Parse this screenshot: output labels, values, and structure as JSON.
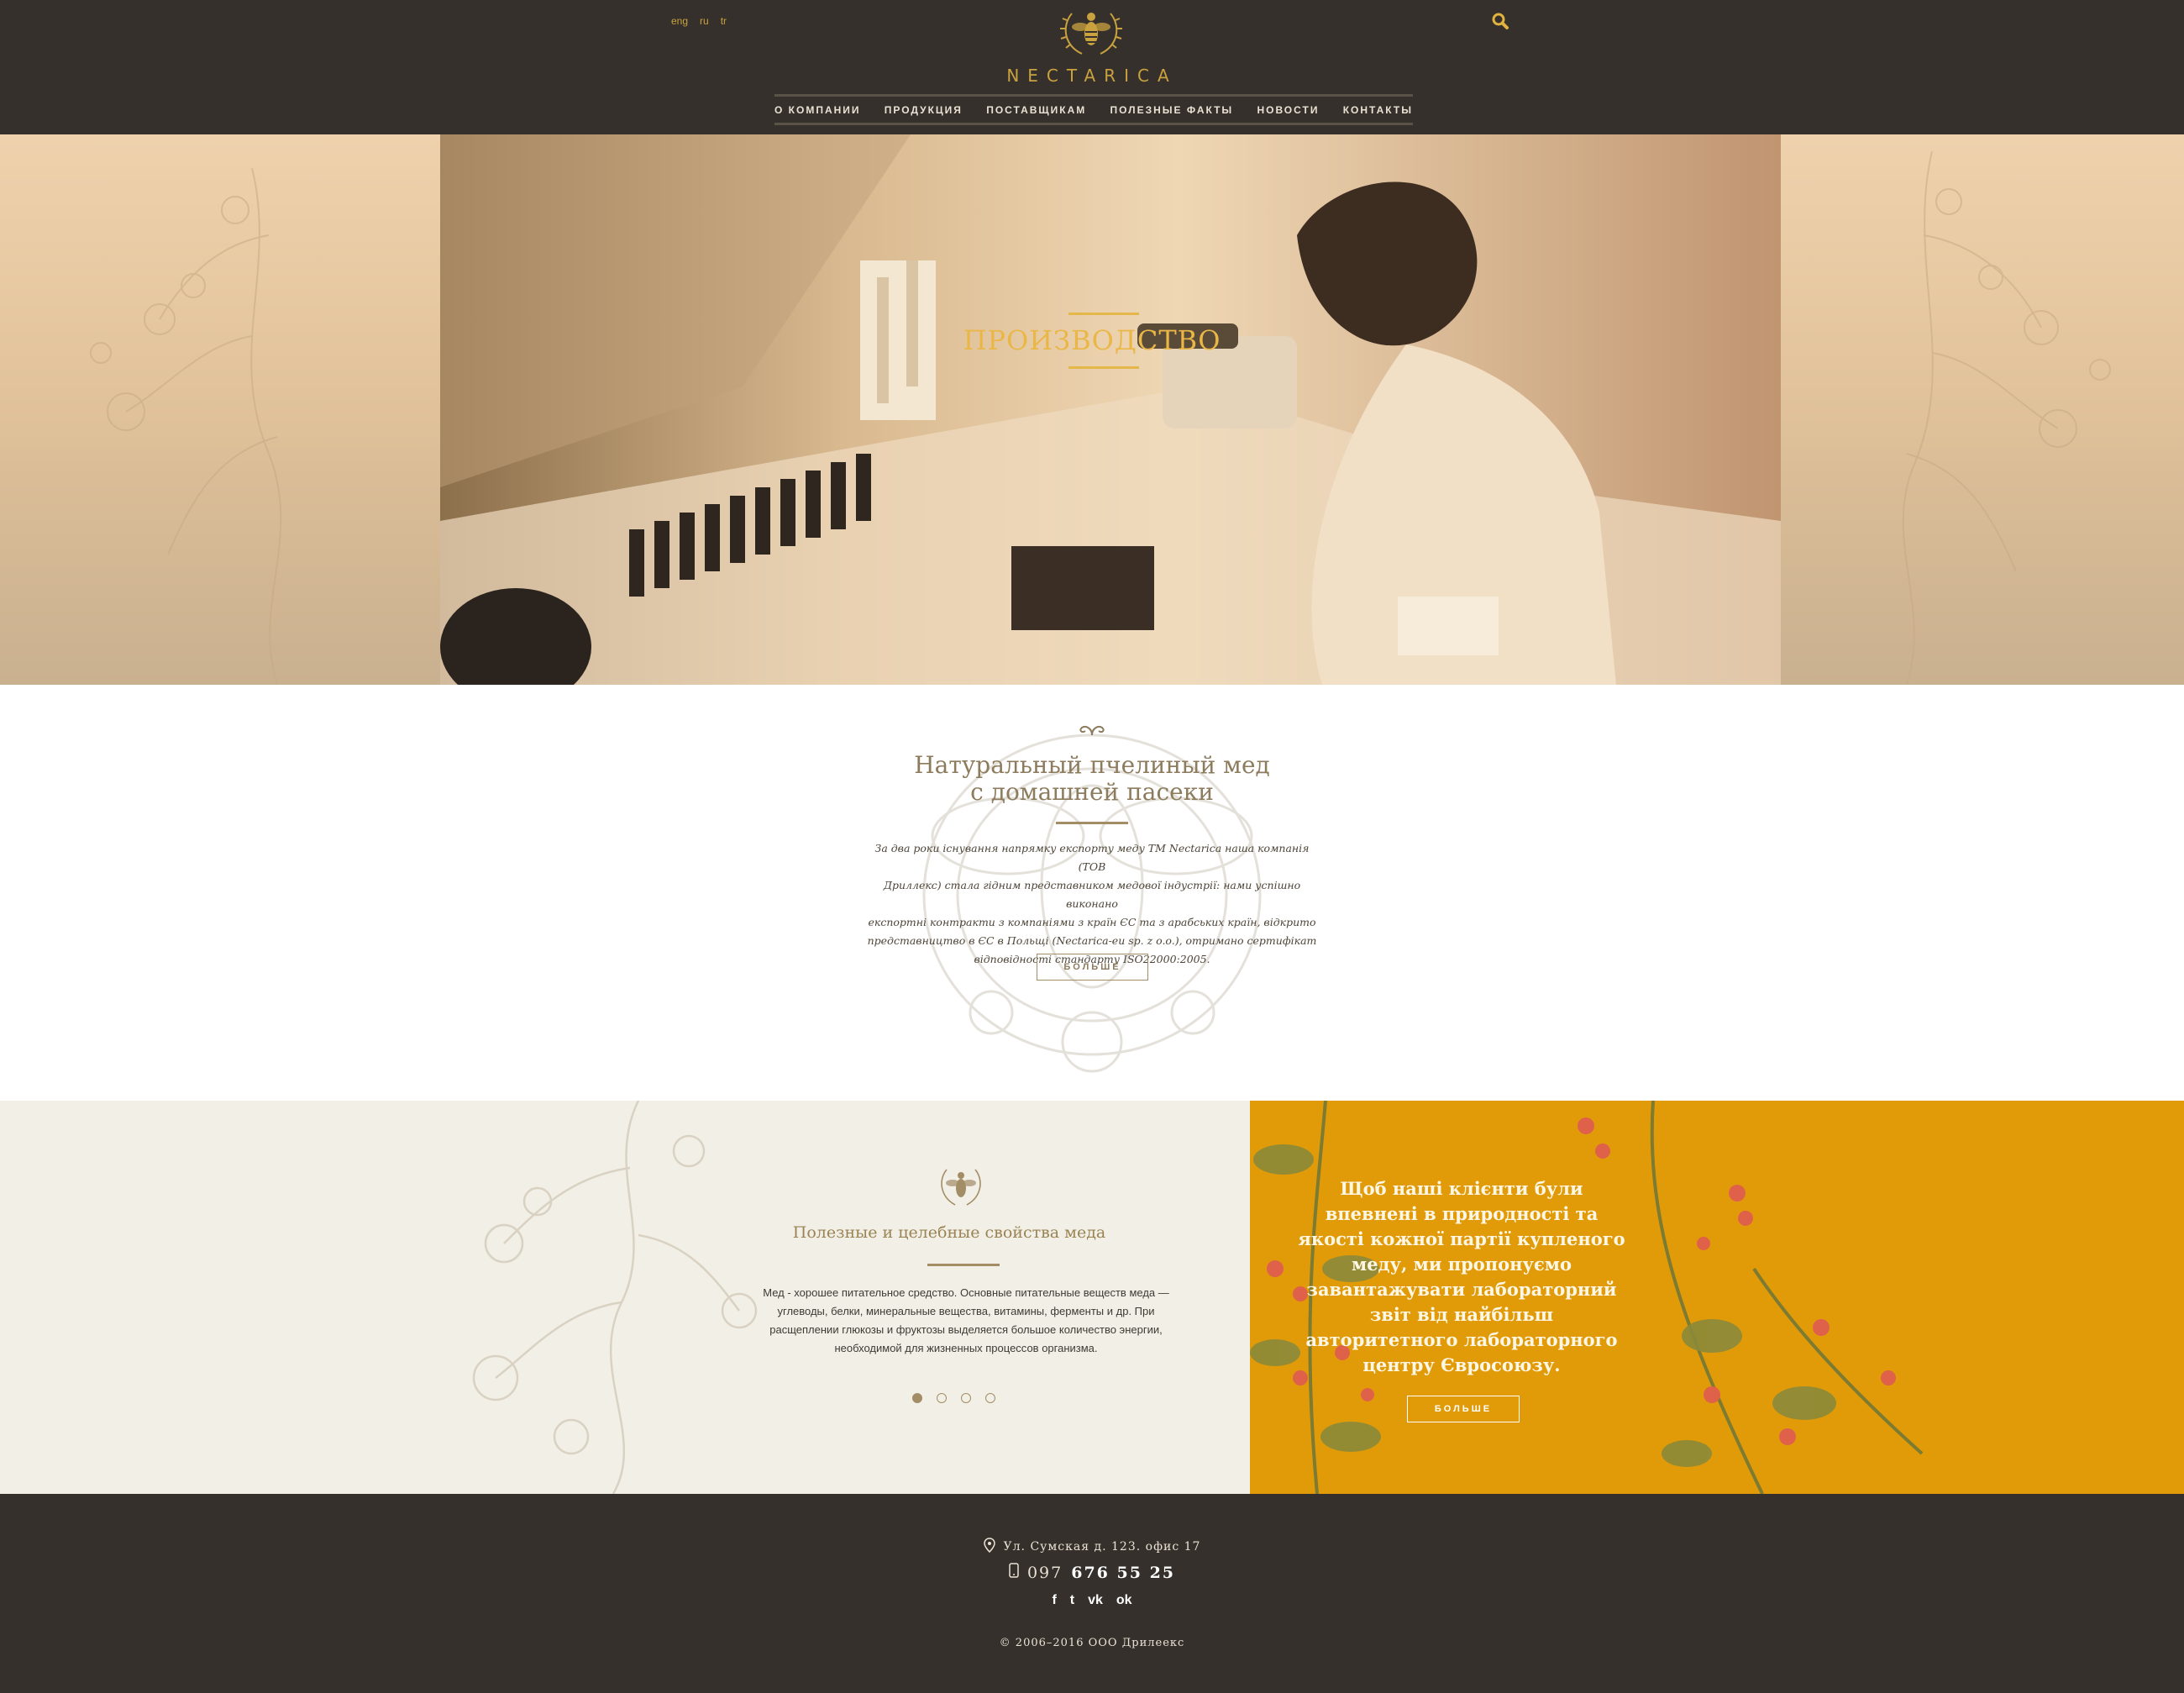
{
  "header": {
    "languages": [
      "eng",
      "ru",
      "tr"
    ],
    "logo_text": "NECTARICA",
    "nav": [
      "О КОМПАНИИ",
      "ПРОДУКЦИЯ",
      "ПОСТАВЩИКАМ",
      "ПОЛЕЗНЫЕ ФАКТЫ",
      "НОВОСТИ",
      "КОНТАКТЫ"
    ]
  },
  "hero": {
    "title": "ПРОИЗВОДСТВО",
    "colors": {
      "title": "#eab747",
      "accent_gold": "#e5b64a"
    }
  },
  "intro": {
    "title_line1": "Натуральный пчелиный мед",
    "title_line2": "с домашней пасеки",
    "text_lines": [
      "За два роки існування напрямку експорту меду ТМ Nectarica наша компанія (ТОВ",
      "Дриллекс) стала гідним представником медової індустрії: нами успішно виконано",
      "експортні контракти з компаніями з країн ЄС та з арабських країн, відкрито",
      "представництво в ЄС в Польщі (Nectarica-eu sp. z o.o.), отримано сертифікат",
      "відповідності стандарту ISO22000:2005."
    ],
    "button": "БОЛЬШЕ"
  },
  "features": {
    "title": "Полезные и целебные свойства меда",
    "text_lines": [
      "Мед - хорошее питательное средство. Основные питательные веществ меда —",
      "углеводы, белки, минеральные вещества, витамины, ферменты и др. При",
      "расщеплении глюкозы и фруктозы выделяется большое количество энергии,",
      "необходимой для жизненных процессов организма."
    ],
    "slider_count": 4,
    "slider_active": 1
  },
  "promo": {
    "text_lines": [
      "Щоб наші клієнти були",
      "впевнені в природності та",
      "якості кожної партії купленого",
      "меду, ми пропонуємо",
      "завантажувати лабораторний",
      "звіт від найбільш",
      "авторитетного лабораторного",
      "центру Євросоюзу."
    ],
    "button": "БОЛЬШЕ",
    "background_color": "#e19b08"
  },
  "footer": {
    "address": "Ул. Сумская д. 123. офис 17",
    "phone_prefix": "097",
    "phone_number": "676 55 25",
    "social": [
      "f",
      "t",
      "vk",
      "ok"
    ],
    "copyright": "© 2006–2016 ООО Дрилеекс"
  },
  "colors": {
    "dark": "#35302b",
    "gold": "#c9a23f",
    "cream": "#f2efe7"
  }
}
